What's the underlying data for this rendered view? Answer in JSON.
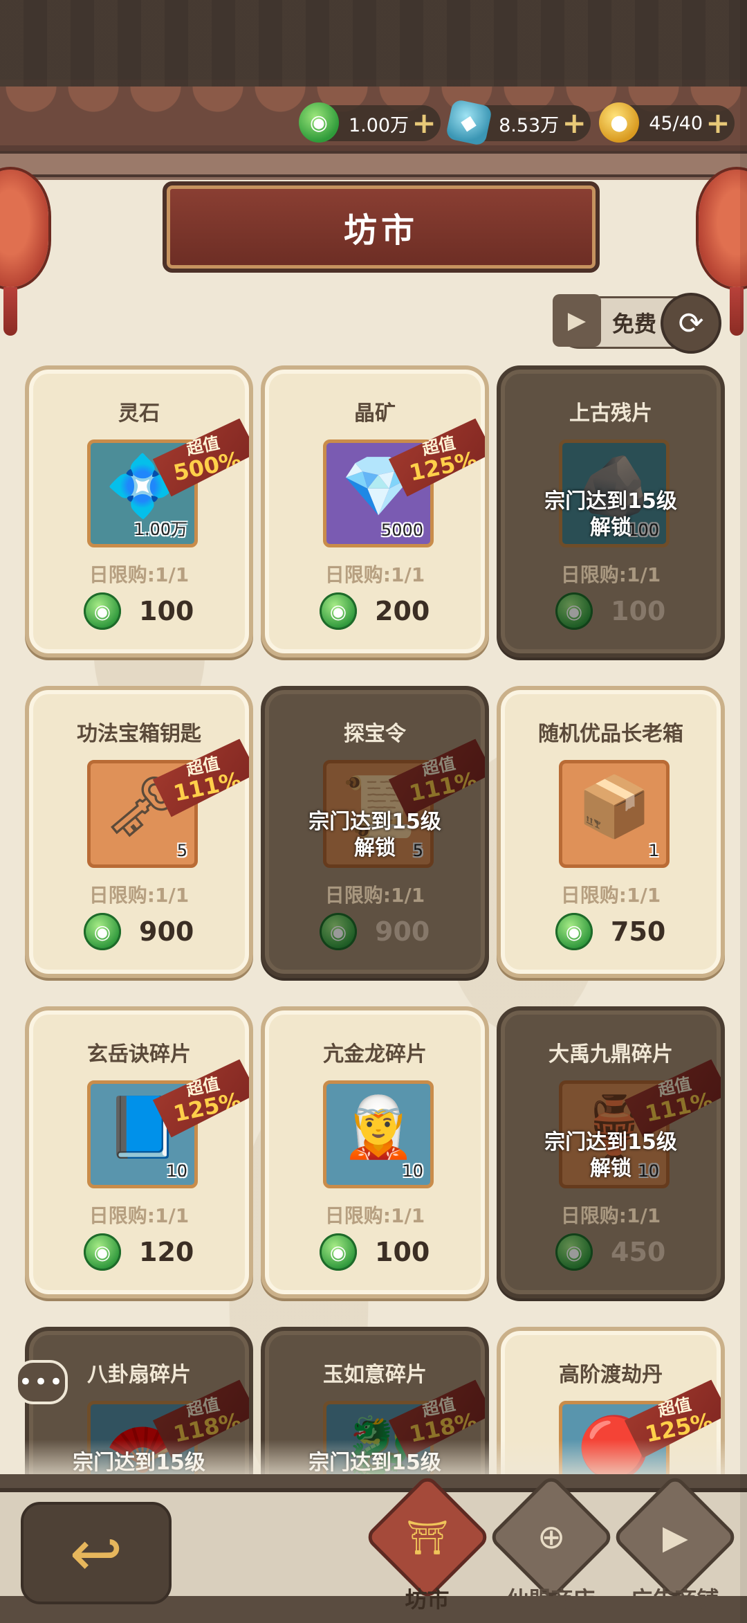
{
  "header": {
    "currencies": [
      {
        "icon": "jade-coin-icon",
        "value": "1.00万",
        "plus": "+"
      },
      {
        "icon": "crystal-ore-icon",
        "value": "8.53万",
        "plus": "+"
      },
      {
        "icon": "gold-token-icon",
        "value": "45/40",
        "plus": "+"
      }
    ],
    "title": "坊市",
    "refresh": {
      "play_icon": "▶",
      "label": "免费",
      "cycle_icon": "⟳"
    }
  },
  "items": [
    {
      "name": "灵石",
      "art": "💠",
      "qty": "1.00万",
      "badge": {
        "line1": "超值",
        "line2": "500%"
      },
      "limit": "日限购:1/1",
      "price": "100",
      "locked": false,
      "slot": "teal"
    },
    {
      "name": "晶矿",
      "art": "💎",
      "qty": "5000",
      "badge": {
        "line1": "超值",
        "line2": "125%"
      },
      "limit": "日限购:1/1",
      "price": "200",
      "locked": false,
      "slot": "purple"
    },
    {
      "name": "上古残片",
      "art": "🪨",
      "qty": "100",
      "badge": null,
      "limit": "日限购:1/1",
      "price": "100",
      "locked": true,
      "lock_line1": "宗门达到15级",
      "lock_line2": "解锁",
      "slot": "teal"
    },
    {
      "name": "功法宝箱钥匙",
      "art": "🗝",
      "qty": "5",
      "badge": {
        "line1": "超值",
        "line2": "111%"
      },
      "limit": "日限购:1/1",
      "price": "900",
      "locked": false,
      "slot": "orange"
    },
    {
      "name": "探宝令",
      "art": "📜",
      "qty": "5",
      "badge": {
        "line1": "超值",
        "line2": "111%"
      },
      "limit": "日限购:1/1",
      "price": "900",
      "locked": true,
      "lock_line1": "宗门达到15级",
      "lock_line2": "解锁",
      "slot": "orange"
    },
    {
      "name": "随机优品长老箱",
      "art": "📦",
      "qty": "1",
      "badge": null,
      "limit": "日限购:1/1",
      "price": "750",
      "locked": false,
      "slot": "orange"
    },
    {
      "name": "玄岳诀碎片",
      "art": "📘",
      "qty": "10",
      "badge": {
        "line1": "超值",
        "line2": "125%"
      },
      "limit": "日限购:1/1",
      "price": "120",
      "locked": false,
      "slot": "lightblue"
    },
    {
      "name": "亢金龙碎片",
      "art": "🧝",
      "qty": "10",
      "badge": null,
      "limit": "日限购:1/1",
      "price": "100",
      "locked": false,
      "slot": "lightblue"
    },
    {
      "name": "大禹九鼎碎片",
      "art": "🏺",
      "qty": "10",
      "badge": {
        "line1": "超值",
        "line2": "111%"
      },
      "limit": "日限购:1/1",
      "price": "450",
      "locked": true,
      "lock_line1": "宗门达到15级",
      "lock_line2": "解锁",
      "slot": "orange"
    },
    {
      "name": "八卦扇碎片",
      "art": "🪭",
      "qty": "",
      "badge": {
        "line1": "超值",
        "line2": "118%"
      },
      "limit": "",
      "price": "",
      "locked": true,
      "lock_line1": "宗门达到15级",
      "lock_line2": "",
      "slot": "lightblue"
    },
    {
      "name": "玉如意碎片",
      "art": "🐉",
      "qty": "",
      "badge": {
        "line1": "超值",
        "line2": "118%"
      },
      "limit": "",
      "price": "",
      "locked": true,
      "lock_line1": "宗门达到15级",
      "lock_line2": "",
      "slot": "lightblue"
    },
    {
      "name": "高阶渡劫丹",
      "art": "🔴",
      "qty": "",
      "badge": {
        "line1": "超值",
        "line2": "125%"
      },
      "limit": "",
      "price": "",
      "locked": false,
      "slot": "lightblue"
    }
  ],
  "chat": {
    "icon": "chat-bubble-icon",
    "text": "•••"
  },
  "nav": {
    "back_icon": "↩",
    "tabs": [
      {
        "label": "坊市",
        "icon": "pagoda-icon",
        "glyph": "⛩",
        "active": true
      },
      {
        "label": "仙盟商店",
        "icon": "alliance-shop-icon",
        "glyph": "⊕",
        "active": false
      },
      {
        "label": "广告商铺",
        "icon": "ad-shop-icon",
        "glyph": "▶",
        "active": false
      }
    ]
  }
}
